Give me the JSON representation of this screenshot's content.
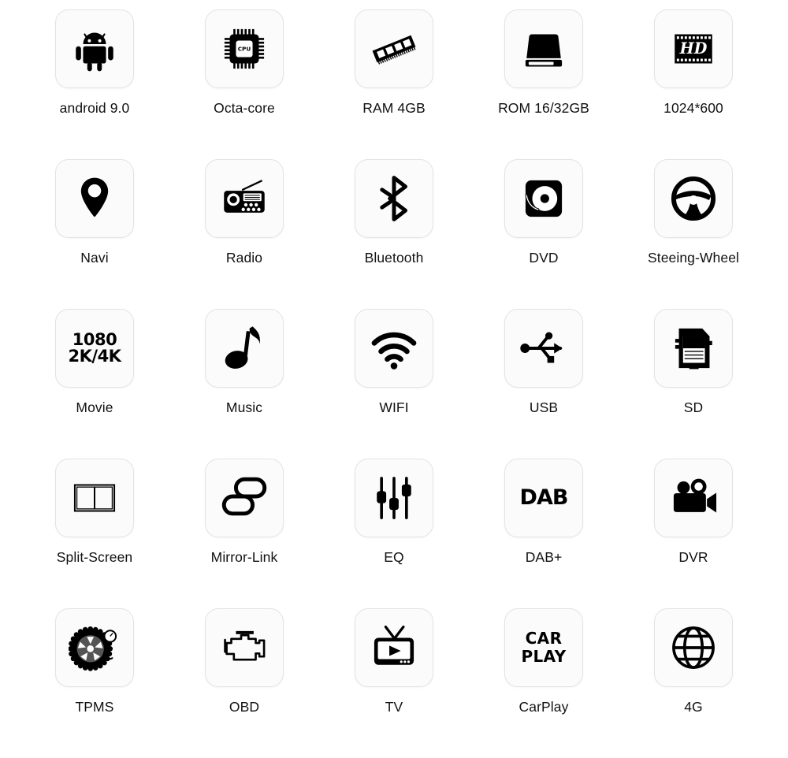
{
  "page": {
    "title": "Car Multimedia Player Feature Grid",
    "background": "#ffffff",
    "icon_color": "#000000",
    "tile_background": "#fbfbfb",
    "tile_border": "#e3e3e3",
    "label_color": "#111111",
    "columns": 5,
    "rows": 5
  },
  "features": [
    {
      "label": "android 9.0",
      "icon": "android-robot-icon"
    },
    {
      "label": "Octa-core",
      "icon": "cpu-chip-icon",
      "icon_text": "CPU"
    },
    {
      "label": "RAM 4GB",
      "icon": "ram-module-icon"
    },
    {
      "label": "ROM 16/32GB",
      "icon": "hard-drive-icon"
    },
    {
      "label": "1024*600",
      "icon": "hd-film-icon",
      "icon_text": "HD"
    },
    {
      "label": "Navi",
      "icon": "map-pin-icon"
    },
    {
      "label": "Radio",
      "icon": "radio-receiver-icon"
    },
    {
      "label": "Bluetooth",
      "icon": "bluetooth-icon"
    },
    {
      "label": "DVD",
      "icon": "dvd-disc-icon"
    },
    {
      "label": "Steeing-Wheel",
      "icon": "steering-wheel-icon"
    },
    {
      "label": "Movie",
      "icon": "resolution-text-icon",
      "icon_text_line1": "1080",
      "icon_text_line2": "2K/4K"
    },
    {
      "label": "Music",
      "icon": "music-note-icon"
    },
    {
      "label": "WIFI",
      "icon": "wifi-icon"
    },
    {
      "label": "USB",
      "icon": "usb-icon"
    },
    {
      "label": "SD",
      "icon": "sd-card-icon"
    },
    {
      "label": "Split-Screen",
      "icon": "split-screen-icon"
    },
    {
      "label": "Mirror-Link",
      "icon": "link-chain-icon"
    },
    {
      "label": "EQ",
      "icon": "equalizer-sliders-icon"
    },
    {
      "label": "DAB+",
      "icon": "dab-text-icon",
      "icon_text": "DAB"
    },
    {
      "label": "DVR",
      "icon": "video-camera-icon"
    },
    {
      "label": "TPMS",
      "icon": "tire-pressure-icon"
    },
    {
      "label": "OBD",
      "icon": "engine-check-icon"
    },
    {
      "label": "TV",
      "icon": "television-icon"
    },
    {
      "label": "CarPlay",
      "icon": "carplay-text-icon",
      "icon_text_line1": "CAR",
      "icon_text_line2": "PLAY"
    },
    {
      "label": "4G",
      "icon": "globe-icon"
    }
  ]
}
